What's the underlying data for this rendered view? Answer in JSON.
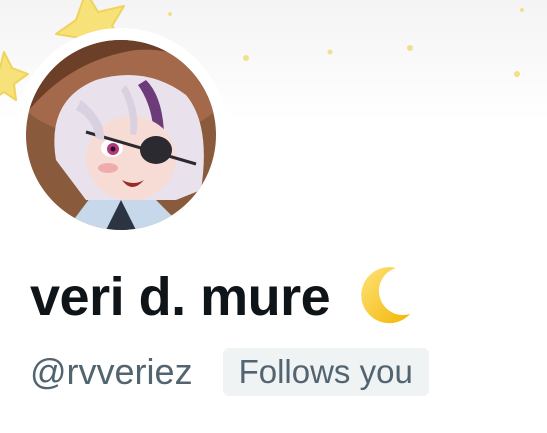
{
  "profile": {
    "display_name": "veri d. mure",
    "name_emoji": "crescent-moon-icon",
    "handle": "@rvveriez",
    "follows_badge": "Follows you"
  },
  "colors": {
    "name_text": "#0f1419",
    "secondary_text": "#536471",
    "badge_background": "#eff3f4",
    "banner_star": "#f7e27a",
    "moon": "#f5c518"
  }
}
